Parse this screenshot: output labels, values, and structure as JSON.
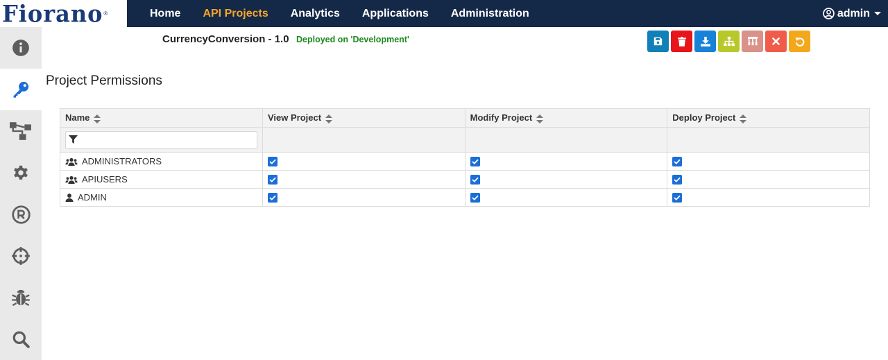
{
  "brand": {
    "logo_text": "Fiorano",
    "logo_mark": "®"
  },
  "nav": {
    "items": [
      {
        "label": "Home"
      },
      {
        "label": "API Projects",
        "active": true
      },
      {
        "label": "Analytics"
      },
      {
        "label": "Applications"
      },
      {
        "label": "Administration"
      }
    ],
    "user_label": "admin"
  },
  "sidebar": {
    "items": [
      {
        "icon": "info-icon"
      },
      {
        "icon": "key-icon",
        "active": true
      },
      {
        "icon": "flow-icon"
      },
      {
        "icon": "gear-icon"
      },
      {
        "icon": "registered-icon"
      },
      {
        "icon": "crosshair-icon"
      },
      {
        "icon": "bug-icon"
      },
      {
        "icon": "search-icon"
      }
    ]
  },
  "project": {
    "title": "CurrencyConversion - 1.0",
    "status": "Deployed on 'Development'"
  },
  "toolbar": {
    "buttons": [
      {
        "icon": "save-icon",
        "color": "#1180b8"
      },
      {
        "icon": "trash-icon",
        "color": "#e8141c"
      },
      {
        "icon": "download-icon",
        "color": "#1782d8"
      },
      {
        "icon": "sitemap-icon",
        "color": "#b7c92a"
      },
      {
        "icon": "hierarchy-icon",
        "color": "#d99188"
      },
      {
        "icon": "close-icon",
        "color": "#f05c4a"
      },
      {
        "icon": "undo-icon",
        "color": "#f3a81c"
      }
    ]
  },
  "section": {
    "title": "Project Permissions"
  },
  "table": {
    "columns": [
      "Name",
      "View Project",
      "Modify Project",
      "Deploy Project"
    ],
    "rows": [
      {
        "type": "group",
        "name": "ADMINISTRATORS",
        "view": true,
        "modify": true,
        "deploy": true
      },
      {
        "type": "group",
        "name": "APIUSERS",
        "view": true,
        "modify": true,
        "deploy": true
      },
      {
        "type": "user",
        "name": "ADMIN",
        "view": true,
        "modify": true,
        "deploy": true
      }
    ]
  },
  "colors": {
    "topbar": "#142847",
    "nav_active": "#f6a52c",
    "status_green": "#1e8a1e",
    "checkbox": "#1b6ed8"
  }
}
